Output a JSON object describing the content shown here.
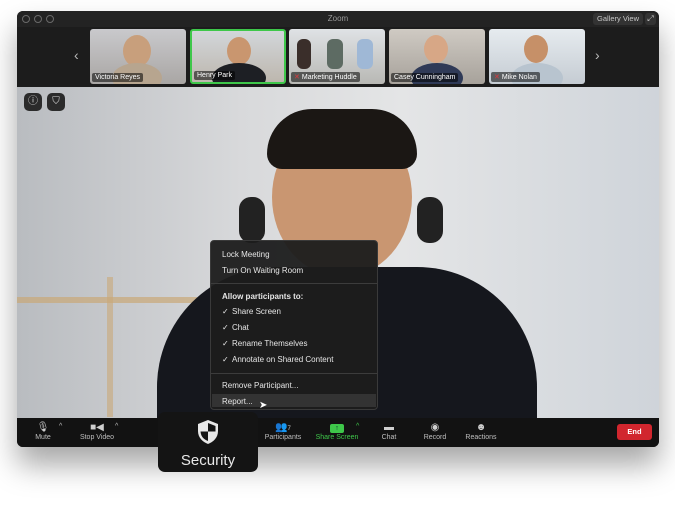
{
  "window": {
    "title": "Zoom",
    "gallery_view_label": "Gallery View"
  },
  "participants_strip": [
    {
      "name": "Victoria Reyes",
      "muted": false,
      "active": false
    },
    {
      "name": "Henry Park",
      "muted": false,
      "active": true
    },
    {
      "name": "Marketing Huddle",
      "muted": true,
      "active": false
    },
    {
      "name": "Casey Cunningham",
      "muted": false,
      "active": false
    },
    {
      "name": "Mike Nolan",
      "muted": true,
      "active": false
    }
  ],
  "security_menu": {
    "items": [
      "Lock Meeting",
      "Turn On Waiting Room"
    ],
    "allow_header": "Allow participants to:",
    "allow_items": [
      "Share Screen",
      "Chat",
      "Rename Themselves",
      "Annotate on Shared Content"
    ],
    "actions": [
      "Remove Participant...",
      "Report..."
    ]
  },
  "toolbar": {
    "mute": "Mute",
    "stop_video": "Stop Video",
    "security": "Security",
    "participants": "Participants",
    "participants_count": "7",
    "share_screen": "Share Screen",
    "chat": "Chat",
    "record": "Record",
    "reactions": "Reactions",
    "end": "End"
  },
  "colors": {
    "active_border": "#3ec74a",
    "share_green": "#3ec74a",
    "end_red": "#d1262e"
  }
}
